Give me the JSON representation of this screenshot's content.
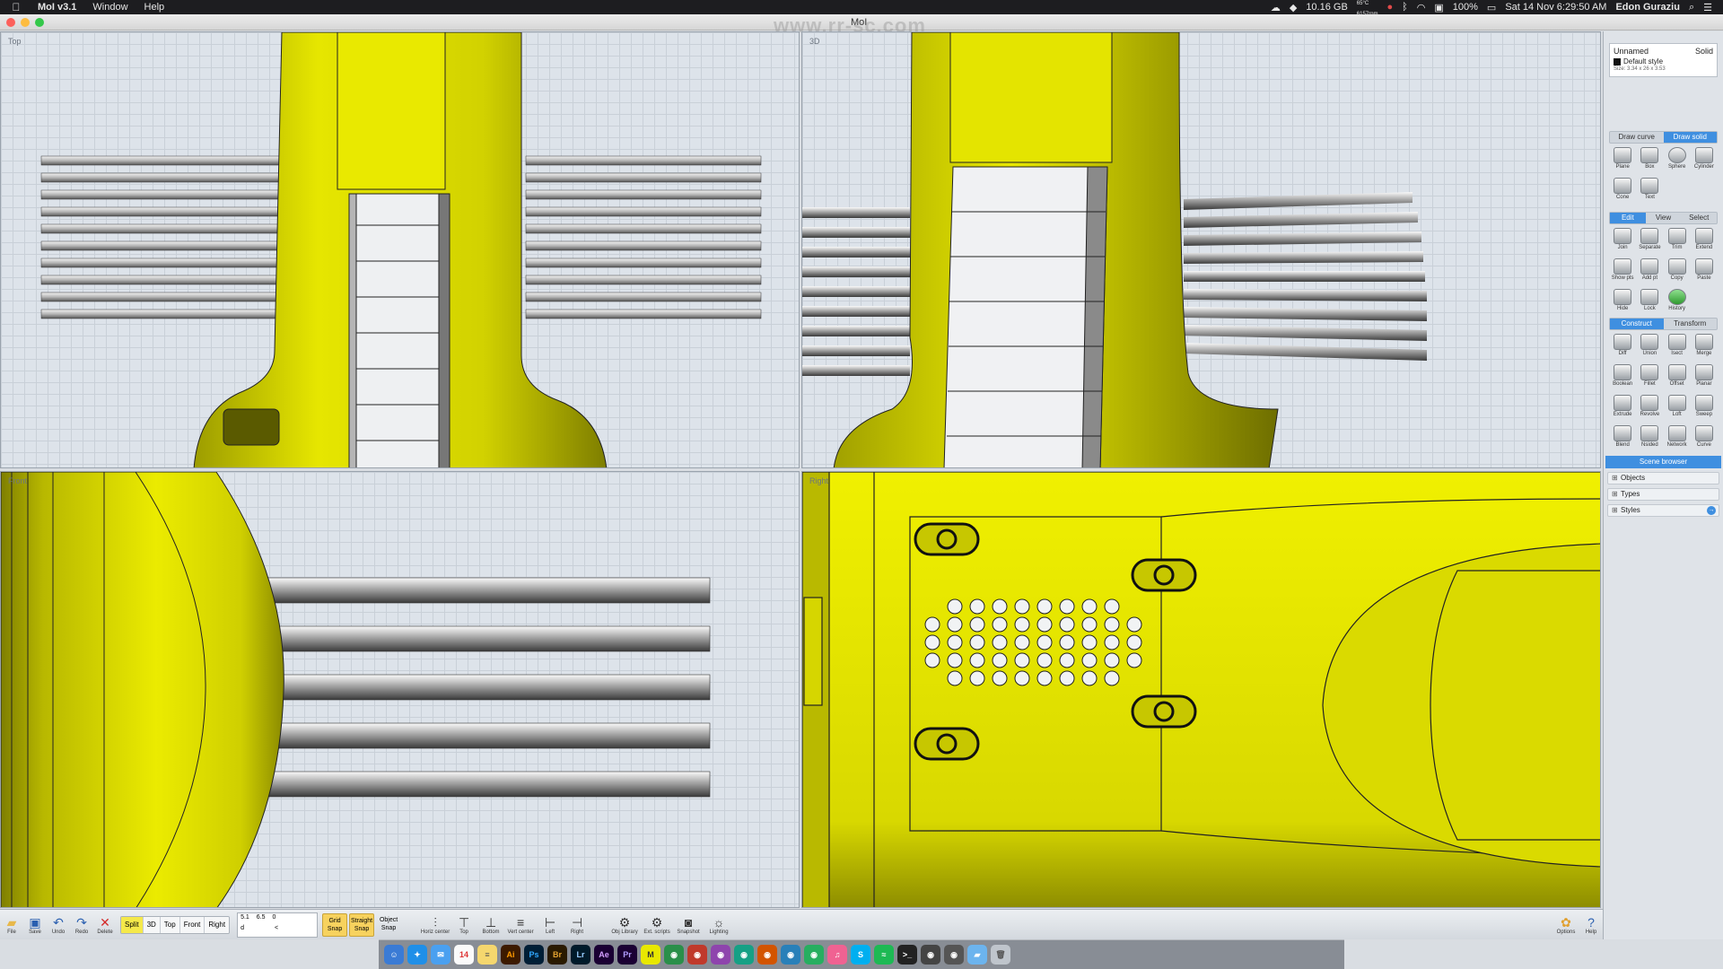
{
  "menubar": {
    "app_name": "MoI v3.1",
    "items": [
      "Window",
      "Help"
    ],
    "status": {
      "memory": "10.16 GB",
      "temp_cpu": "65°C",
      "fan_rpm": "6157rpm",
      "battery": "100%",
      "datetime": "Sat 14 Nov 6:29:50 AM",
      "user": "Edon Guraziu"
    }
  },
  "window": {
    "title": "MoI"
  },
  "viewports": {
    "top": "Top",
    "threed": "3D",
    "front": "Front",
    "right": "Right"
  },
  "panel": {
    "properties": {
      "name": "Unnamed",
      "type": "Solid",
      "style": "Default style",
      "size": "Size: 3.34 x 26 x 3.53"
    },
    "draw_tabs": [
      "Draw curve",
      "Draw solid"
    ],
    "draw_tools": [
      "Plane",
      "Box",
      "Sphere",
      "Cylinder",
      "Cone",
      "Text"
    ],
    "edit_tabs": [
      "Edit",
      "View",
      "Select"
    ],
    "edit_tools": [
      "Join",
      "Separate",
      "Trim",
      "Extend",
      "Show pts",
      "Add pt",
      "Copy",
      "Paste",
      "Hide",
      "Lock",
      "History"
    ],
    "construct_tabs": [
      "Construct",
      "Transform"
    ],
    "construct_tools": [
      "Diff",
      "Union",
      "Isect",
      "Merge",
      "Boolean",
      "Fillet",
      "Offset",
      "Planar",
      "Extrude",
      "Revolve",
      "Loft",
      "Sweep",
      "Blend",
      "Nsided",
      "Network",
      "Curve"
    ],
    "scene_browser": {
      "title": "Scene browser",
      "rows": [
        "Objects",
        "Types",
        "Styles"
      ]
    }
  },
  "bottombar": {
    "file_buttons": [
      "File",
      "Save",
      "Undo",
      "Redo",
      "Delete"
    ],
    "views": [
      "Split",
      "3D",
      "Top",
      "Front",
      "Right"
    ],
    "coords": {
      "x": "5.1",
      "y": "6.5",
      "z": "0",
      "d_label": "d",
      "angle_label": "<"
    },
    "snaps": [
      "Grid Snap",
      "Straight Snap",
      "Object Snap"
    ],
    "align_buttons": [
      "Horiz center",
      "Top",
      "Bottom",
      "Vert center",
      "Left",
      "Right"
    ],
    "extra_buttons": [
      "Obj Library",
      "Ext. scripts",
      "Snapshot",
      "Lighting"
    ],
    "right_buttons": [
      "Options",
      "Help"
    ]
  },
  "colors": {
    "model_yellow": "#dcdc00",
    "accent_blue": "#3f8fe0",
    "grid": "#c9d0d8",
    "viewport_bg": "#dde3ea"
  },
  "watermark": "www.rr-sc.com",
  "dock_icons": [
    "finder",
    "safari",
    "mail",
    "calendar",
    "notes",
    "illustrator",
    "photoshop",
    "bridge",
    "lightroom",
    "after-effects",
    "premiere",
    "terminal",
    "trash"
  ]
}
